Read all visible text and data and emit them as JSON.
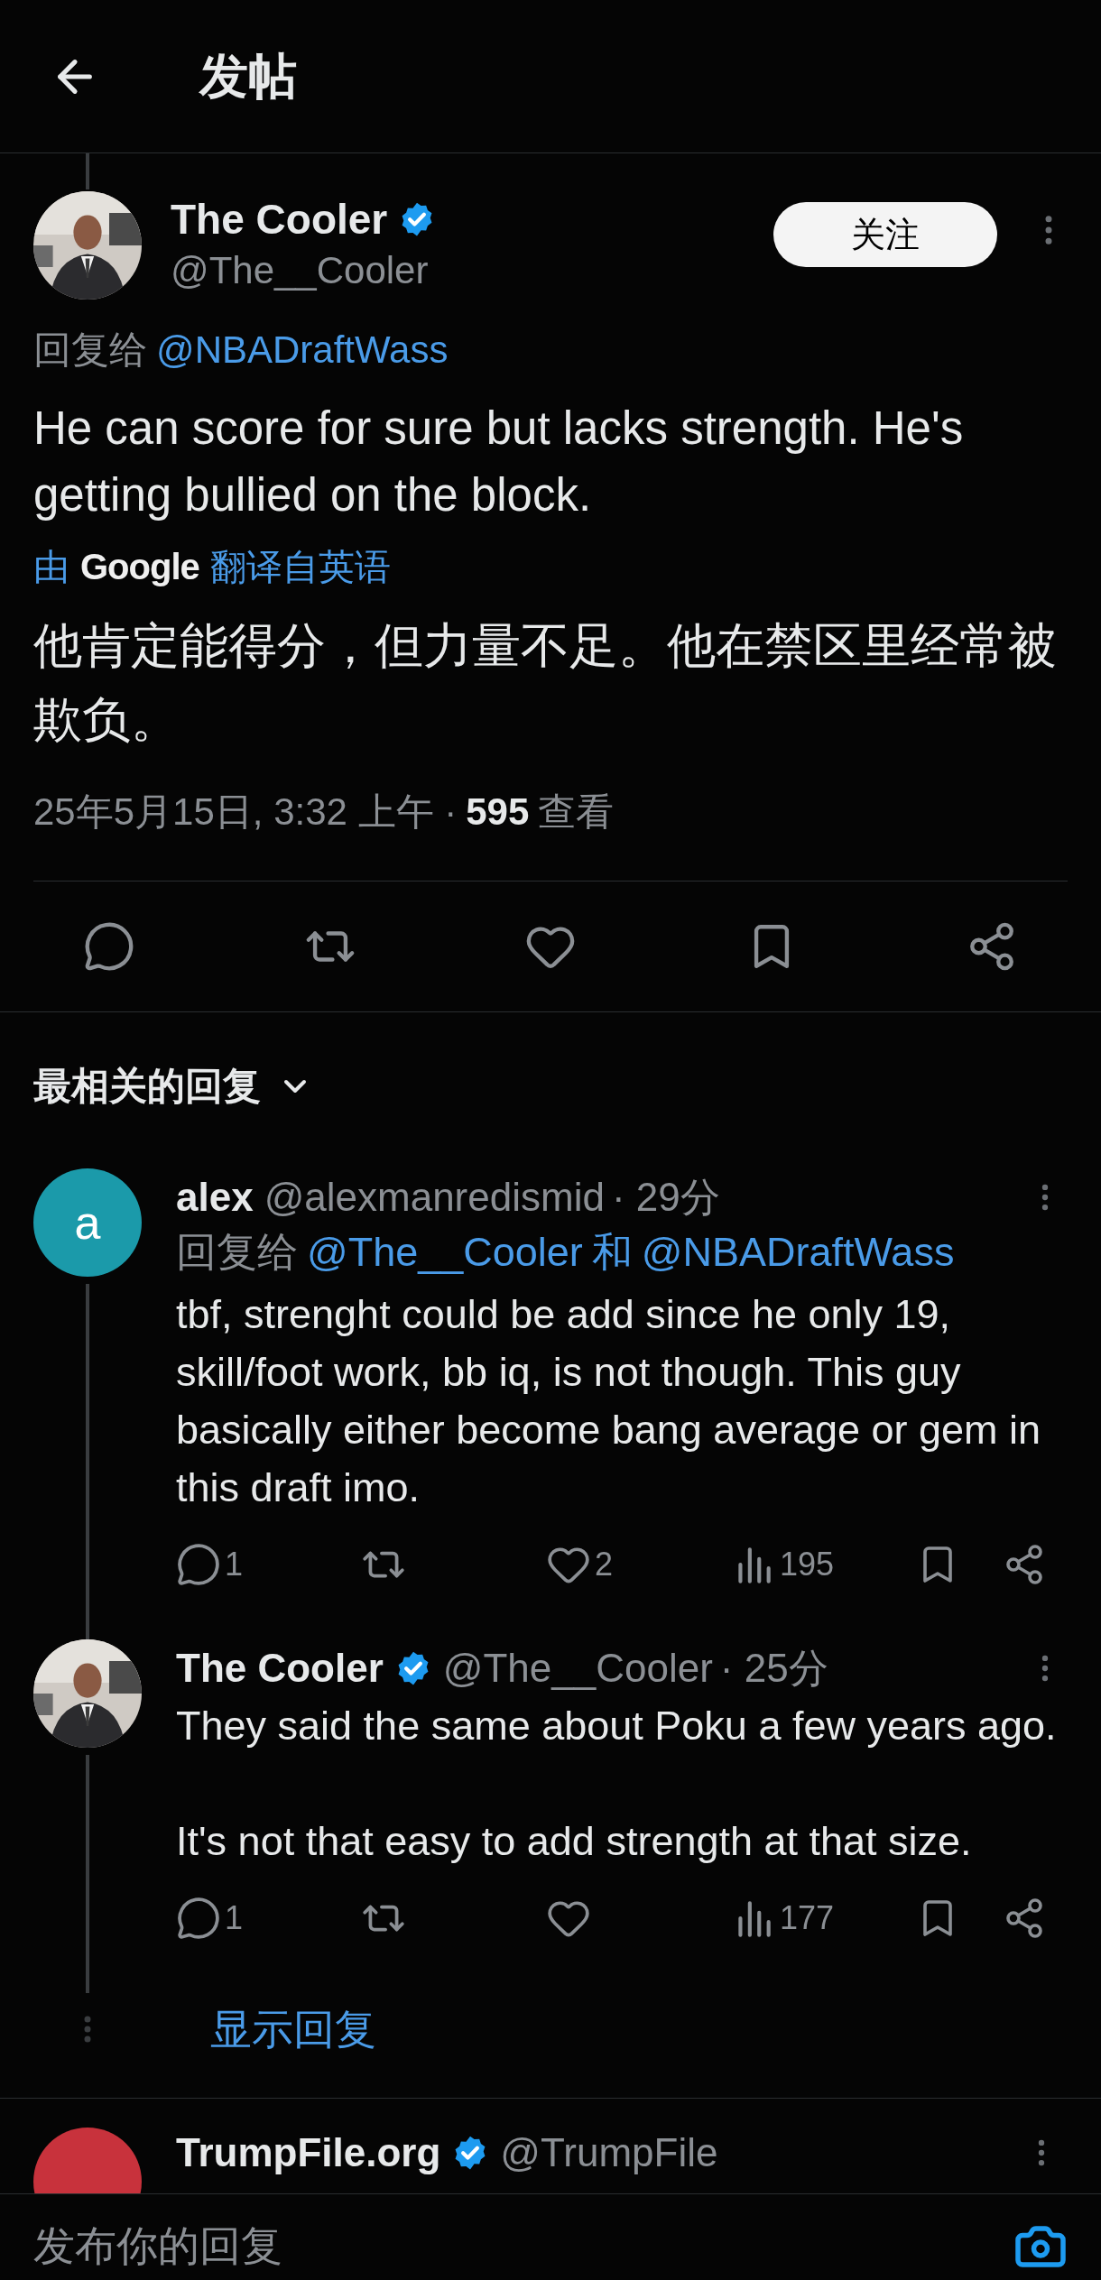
{
  "header": {
    "title": "发帖"
  },
  "tweet": {
    "author": {
      "name": "The Cooler",
      "verified": true,
      "handle": "@The__Cooler"
    },
    "follow_button": "关注",
    "reply_to": {
      "label": "回复给",
      "mentions": [
        "@NBADraftWass"
      ]
    },
    "text": "He can score for sure but lacks strength. He's getting bullied on the block.",
    "translation": {
      "prefix": "由",
      "provider": "Google",
      "suffix": "翻译自英语",
      "text": "他肯定能得分，但力量不足。他在禁区里经常被欺负。"
    },
    "meta": {
      "timestamp": "25年5月15日, 3:32 上午 ·",
      "views": "595",
      "views_label": "查看"
    },
    "actions": [
      {
        "kind": "reply"
      },
      {
        "kind": "retweet"
      },
      {
        "kind": "like"
      },
      {
        "kind": "bookmark"
      },
      {
        "kind": "share"
      }
    ]
  },
  "replies_sort": {
    "label": "最相关的回复"
  },
  "thread": {
    "replies": [
      {
        "author": {
          "name": "alex",
          "verified": false,
          "handle": "@alexmanredismid"
        },
        "time": "· 29分",
        "avatar": {
          "kind": "letter",
          "letter": "a",
          "color": "#1b9aaa"
        },
        "reply_to": {
          "label": "回复给",
          "mentions": [
            "@The__Cooler",
            "@NBADraftWass"
          ],
          "joiner": "和"
        },
        "text": "tbf, strenght could be add since he only 19, skill/foot work, bb iq, is not though. This guy basically either become bang average or gem in this draft imo.",
        "actions": [
          {
            "kind": "reply",
            "count": "1"
          },
          {
            "kind": "retweet"
          },
          {
            "kind": "like",
            "count": "2"
          },
          {
            "kind": "views",
            "count": "195"
          },
          {
            "kind": "bookmark"
          },
          {
            "kind": "share"
          }
        ]
      },
      {
        "author": {
          "name": "The Cooler",
          "verified": true,
          "handle": "@The__Cooler"
        },
        "time": "· 25分",
        "text": "They said the same about Poku a few years ago.\n\nIt's not that easy to add strength at that size.",
        "actions": [
          {
            "kind": "reply",
            "count": "1"
          },
          {
            "kind": "retweet"
          },
          {
            "kind": "like"
          },
          {
            "kind": "views",
            "count": "177"
          },
          {
            "kind": "bookmark"
          },
          {
            "kind": "share"
          }
        ]
      }
    ],
    "show_replies": "显示回复"
  },
  "next_reply": {
    "author": {
      "name": "TrumpFile.org",
      "verified": true,
      "handle": "@TrumpFile"
    },
    "avatar": {
      "kind": "circle",
      "color": "#c8323c"
    }
  },
  "bottom_bar": {
    "placeholder": "发布你的回复"
  }
}
